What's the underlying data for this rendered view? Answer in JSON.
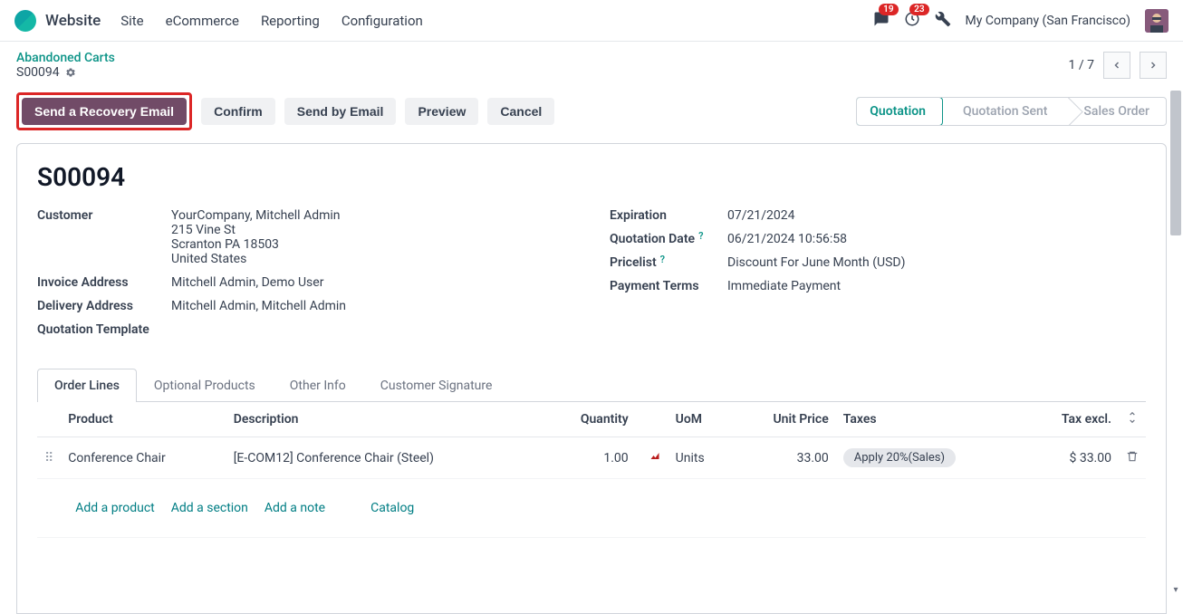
{
  "nav": {
    "brand": "Website",
    "items": [
      "Site",
      "eCommerce",
      "Reporting",
      "Configuration"
    ],
    "badge_msg": "19",
    "badge_act": "23",
    "company": "My Company (San Francisco)"
  },
  "crumb": {
    "parent": "Abandoned Carts",
    "current": "S00094",
    "pager": "1 / 7"
  },
  "actions": {
    "recovery": "Send a Recovery Email",
    "confirm": "Confirm",
    "send": "Send by Email",
    "preview": "Preview",
    "cancel": "Cancel"
  },
  "status": {
    "quotation": "Quotation",
    "sent": "Quotation Sent",
    "order": "Sales Order"
  },
  "doc": {
    "title": "S00094",
    "labels": {
      "customer": "Customer",
      "invoice": "Invoice Address",
      "delivery": "Delivery Address",
      "template": "Quotation Template",
      "expiration": "Expiration",
      "qdate": "Quotation Date",
      "pricelist": "Pricelist",
      "terms": "Payment Terms"
    },
    "customer_name": "YourCompany, Mitchell Admin",
    "customer_addr1": "215 Vine St",
    "customer_addr2": "Scranton PA 18503",
    "customer_addr3": "United States",
    "invoice": "Mitchell Admin, Demo User",
    "delivery": "Mitchell Admin, Mitchell Admin",
    "expiration": "07/21/2024",
    "qdate": "06/21/2024 10:56:58",
    "pricelist": "Discount For June Month (USD)",
    "terms": "Immediate Payment"
  },
  "tabs": {
    "lines": "Order Lines",
    "optional": "Optional Products",
    "other": "Other Info",
    "sig": "Customer Signature"
  },
  "table": {
    "h_product": "Product",
    "h_desc": "Description",
    "h_qty": "Quantity",
    "h_uom": "UoM",
    "h_price": "Unit Price",
    "h_tax": "Taxes",
    "h_excl": "Tax excl.",
    "row": {
      "product": "Conference Chair",
      "desc": "[E-COM12] Conference Chair (Steel)",
      "qty": "1.00",
      "uom": "Units",
      "price": "33.00",
      "tax": "Apply 20%(Sales)",
      "excl": "$ 33.00"
    },
    "add_product": "Add a product",
    "add_section": "Add a section",
    "add_note": "Add a note",
    "catalog": "Catalog"
  }
}
